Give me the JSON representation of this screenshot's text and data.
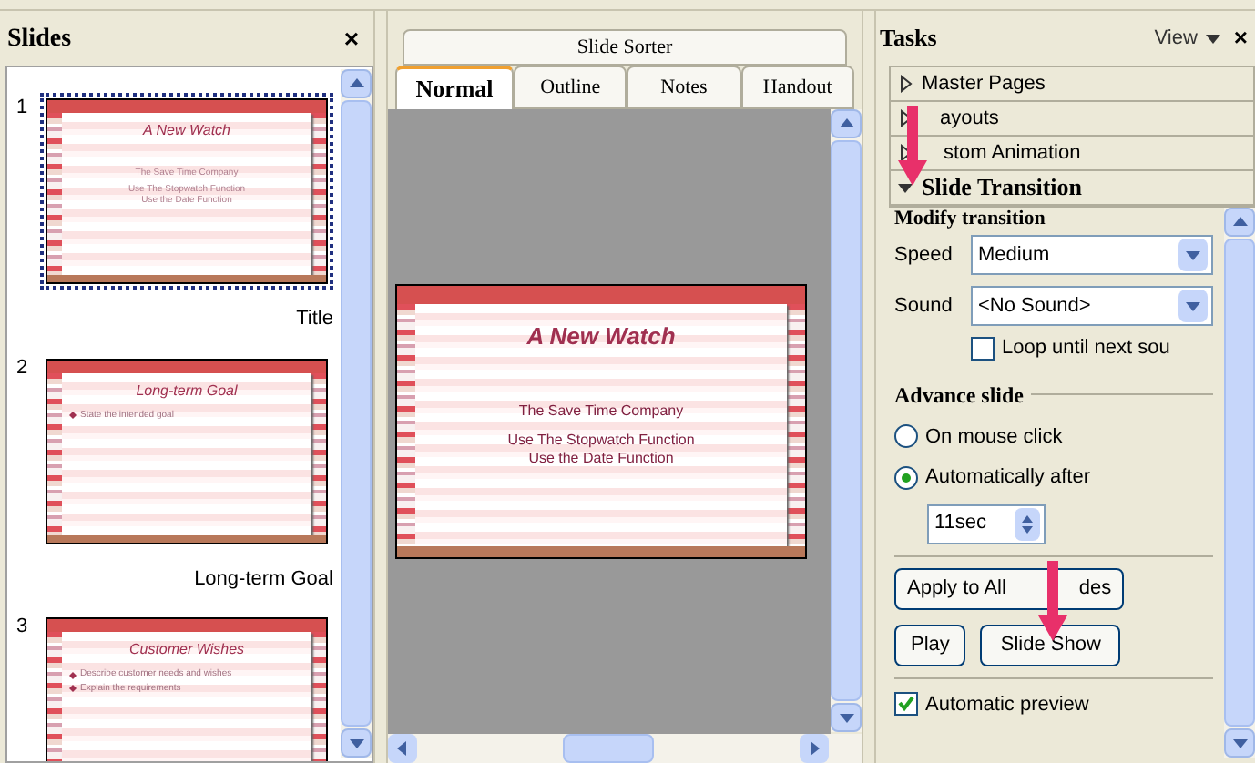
{
  "slides_panel": {
    "title": "Slides",
    "close": "×",
    "slides": [
      {
        "number": "1",
        "kind": "title",
        "title": "A New Watch",
        "groups": [
          [
            "The Save Time Company"
          ],
          [
            "Use The Stopwatch Function",
            "Use the Date Function"
          ]
        ],
        "caption": "Title",
        "selected": true
      },
      {
        "number": "2",
        "kind": "bullets",
        "title": "Long-term Goal",
        "lines": [
          "State the intended goal"
        ],
        "caption": "Long-term Goal",
        "selected": false
      },
      {
        "number": "3",
        "kind": "bullets",
        "title": "Customer Wishes",
        "lines": [
          "Describe customer needs and wishes",
          "Explain the requirements"
        ],
        "selected": false
      }
    ]
  },
  "view_tabs": {
    "top": [
      {
        "label": "Slide Sorter",
        "selected": false
      }
    ],
    "bottom": [
      {
        "label": "Normal",
        "selected": true
      },
      {
        "label": "Outline",
        "selected": false
      },
      {
        "label": "Notes",
        "selected": false
      },
      {
        "label": "Handout",
        "selected": false
      }
    ]
  },
  "main_slide": {
    "title": "A New Watch",
    "groups": [
      [
        "The Save Time Company"
      ],
      [
        "Use The Stopwatch Function",
        "Use the Date Function"
      ]
    ]
  },
  "tasks_panel": {
    "title": "Tasks",
    "view": "View",
    "close": "×",
    "sections": [
      {
        "label": "Master Pages",
        "expanded": false
      },
      {
        "label": "ayouts",
        "expanded": false
      },
      {
        "label": "stom Animation",
        "expanded": false
      },
      {
        "label": "Slide Transition",
        "expanded": true
      }
    ],
    "heading": "Modify transition",
    "speed": {
      "label": "Speed",
      "value": "Medium"
    },
    "sound": {
      "label": "Sound",
      "value": "<No Sound>"
    },
    "loop": {
      "label": "Loop until next sou",
      "checked": false
    },
    "advance": {
      "title": "Advance slide",
      "options": [
        {
          "label": "On mouse click",
          "selected": false
        },
        {
          "label": "Automatically after",
          "selected": true
        }
      ],
      "time": "11sec"
    },
    "apply_button": [
      "Apply to All",
      "des"
    ],
    "play_button": "Play",
    "show_button": "Slide Show",
    "preview": {
      "label": "Automatic preview",
      "checked": true
    }
  }
}
